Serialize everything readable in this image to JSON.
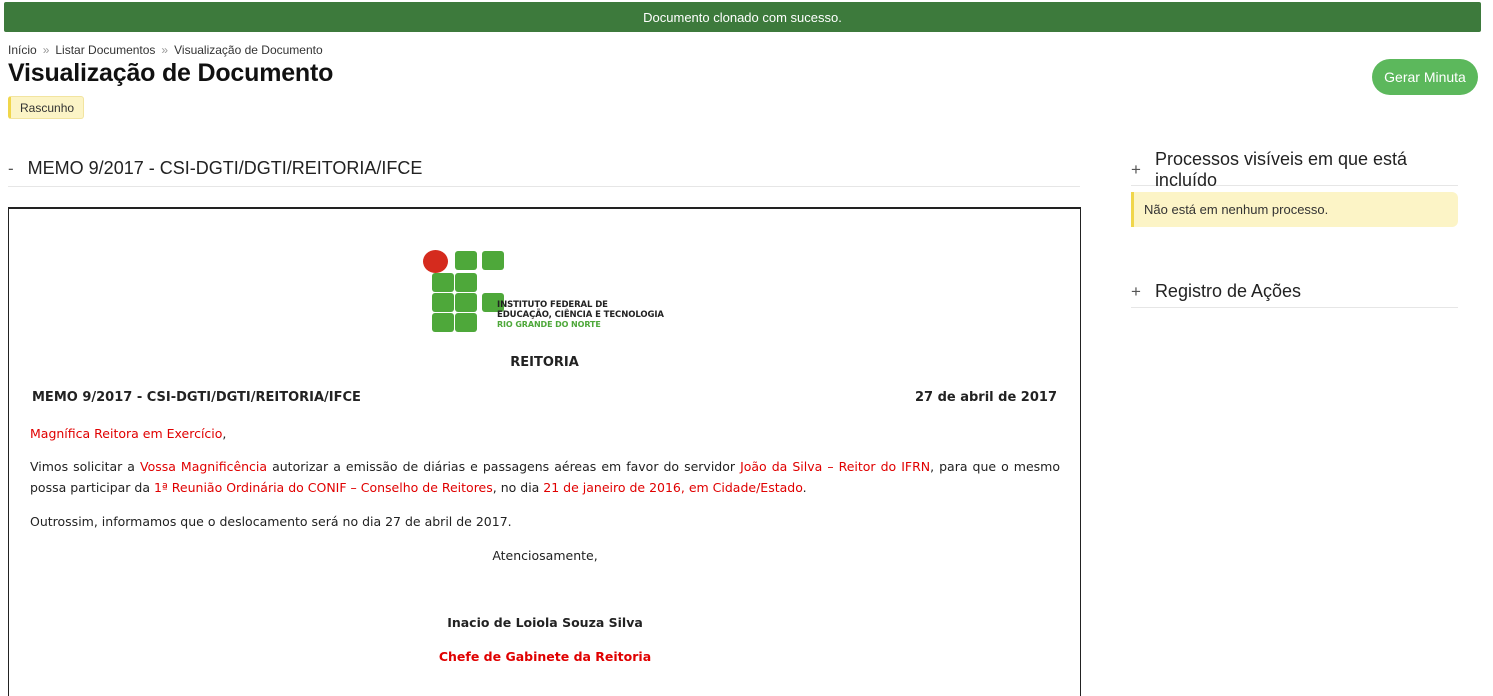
{
  "flash": {
    "message": "Documento clonado com sucesso."
  },
  "breadcrumb": {
    "items": [
      "Início",
      "Listar Documentos",
      "Visualização de Documento"
    ],
    "separator": "»"
  },
  "page": {
    "title": "Visualização de Documento",
    "status": "Rascunho"
  },
  "actions": {
    "gerar_minuta": "Gerar Minuta"
  },
  "document_section": {
    "toggle": "-",
    "title": "MEMO 9/2017 - CSI-DGTI/DGTI/REITORIA/IFCE"
  },
  "processes_section": {
    "toggle": "+",
    "title": "Processos visíveis em que está incluído",
    "empty_message": "Não está em nenhum processo."
  },
  "actions_log_section": {
    "toggle": "+",
    "title": "Registro de Ações"
  },
  "document": {
    "logo": {
      "line1": "INSTITUTO FEDERAL DE",
      "line2": "EDUCAÇÃO, CIÊNCIA E TECNOLOGIA",
      "line3": "RIO GRANDE DO NORTE"
    },
    "heading": "REITORIA",
    "memo_number": "MEMO 9/2017 - CSI-DGTI/DGTI/REITORIA/IFCE",
    "date": "27 de abril de 2017",
    "salutation": {
      "recipient": "Magnífica Reitora em Exercício",
      "suffix": ","
    },
    "body1": {
      "t1": "Vimos solicitar a ",
      "r1": "Vossa Magnificência",
      "t2": " autorizar a emissão de diárias e passagens aéreas em favor do servidor ",
      "r2": "João da Silva – Reitor do IFRN",
      "t3": ", para que o mesmo possa participar da ",
      "r3": "1ª Reunião Ordinária do CONIF – Conselho de Reitores",
      "t4": ", no dia ",
      "r4": "21 de janeiro de 2016, em Cidade/Estado",
      "t5": "."
    },
    "body2": "Outrossim, informamos que o deslocamento será no dia 27 de abril de 2017.",
    "closing": "Atenciosamente,",
    "signer_name": "Inacio de Loiola Souza Silva",
    "signer_role": "Chefe de Gabinete da Reitoria"
  },
  "colors": {
    "flash_bg": "#3d7a3c",
    "button_green": "#5cb85c",
    "badge_yellow": "#fcf4c6",
    "highlight_red": "#e00000",
    "logo_green": "#4ea83a",
    "logo_red": "#d52b1e"
  }
}
